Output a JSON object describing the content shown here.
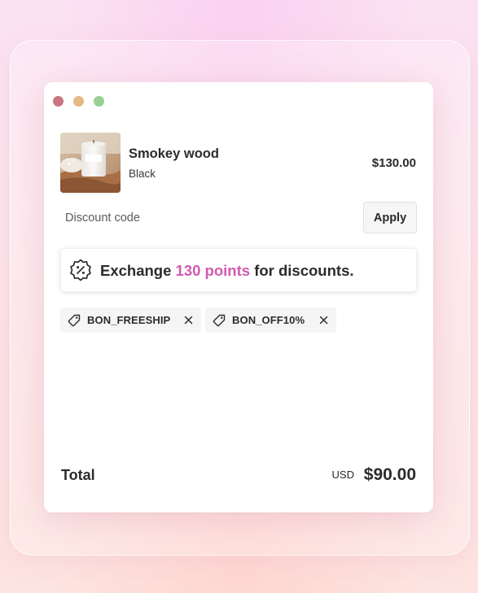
{
  "window": {
    "controls": {
      "close_color": "#c97682",
      "minimize_color": "#e4b887",
      "zoom_color": "#98cf92"
    }
  },
  "cart_item": {
    "name": "Smokey wood",
    "variant": "Black",
    "price": "$130.00",
    "image": "scented-candle-photo"
  },
  "discount": {
    "placeholder": "Discount code",
    "apply_label": "Apply"
  },
  "points_offer": {
    "icon": "discount-badge-icon",
    "text_before": "Exchange",
    "highlight": "130 points",
    "text_after": "for discounts.",
    "highlight_color": "#d05bb0"
  },
  "applied_codes": [
    {
      "code": "BON_FREESHIP",
      "icon": "tag-icon",
      "remove_icon": "close-icon"
    },
    {
      "code": "BON_OFF10%",
      "icon": "tag-icon",
      "remove_icon": "close-icon"
    }
  ],
  "summary": {
    "total_label": "Total",
    "currency": "USD",
    "total_amount": "$90.00"
  }
}
